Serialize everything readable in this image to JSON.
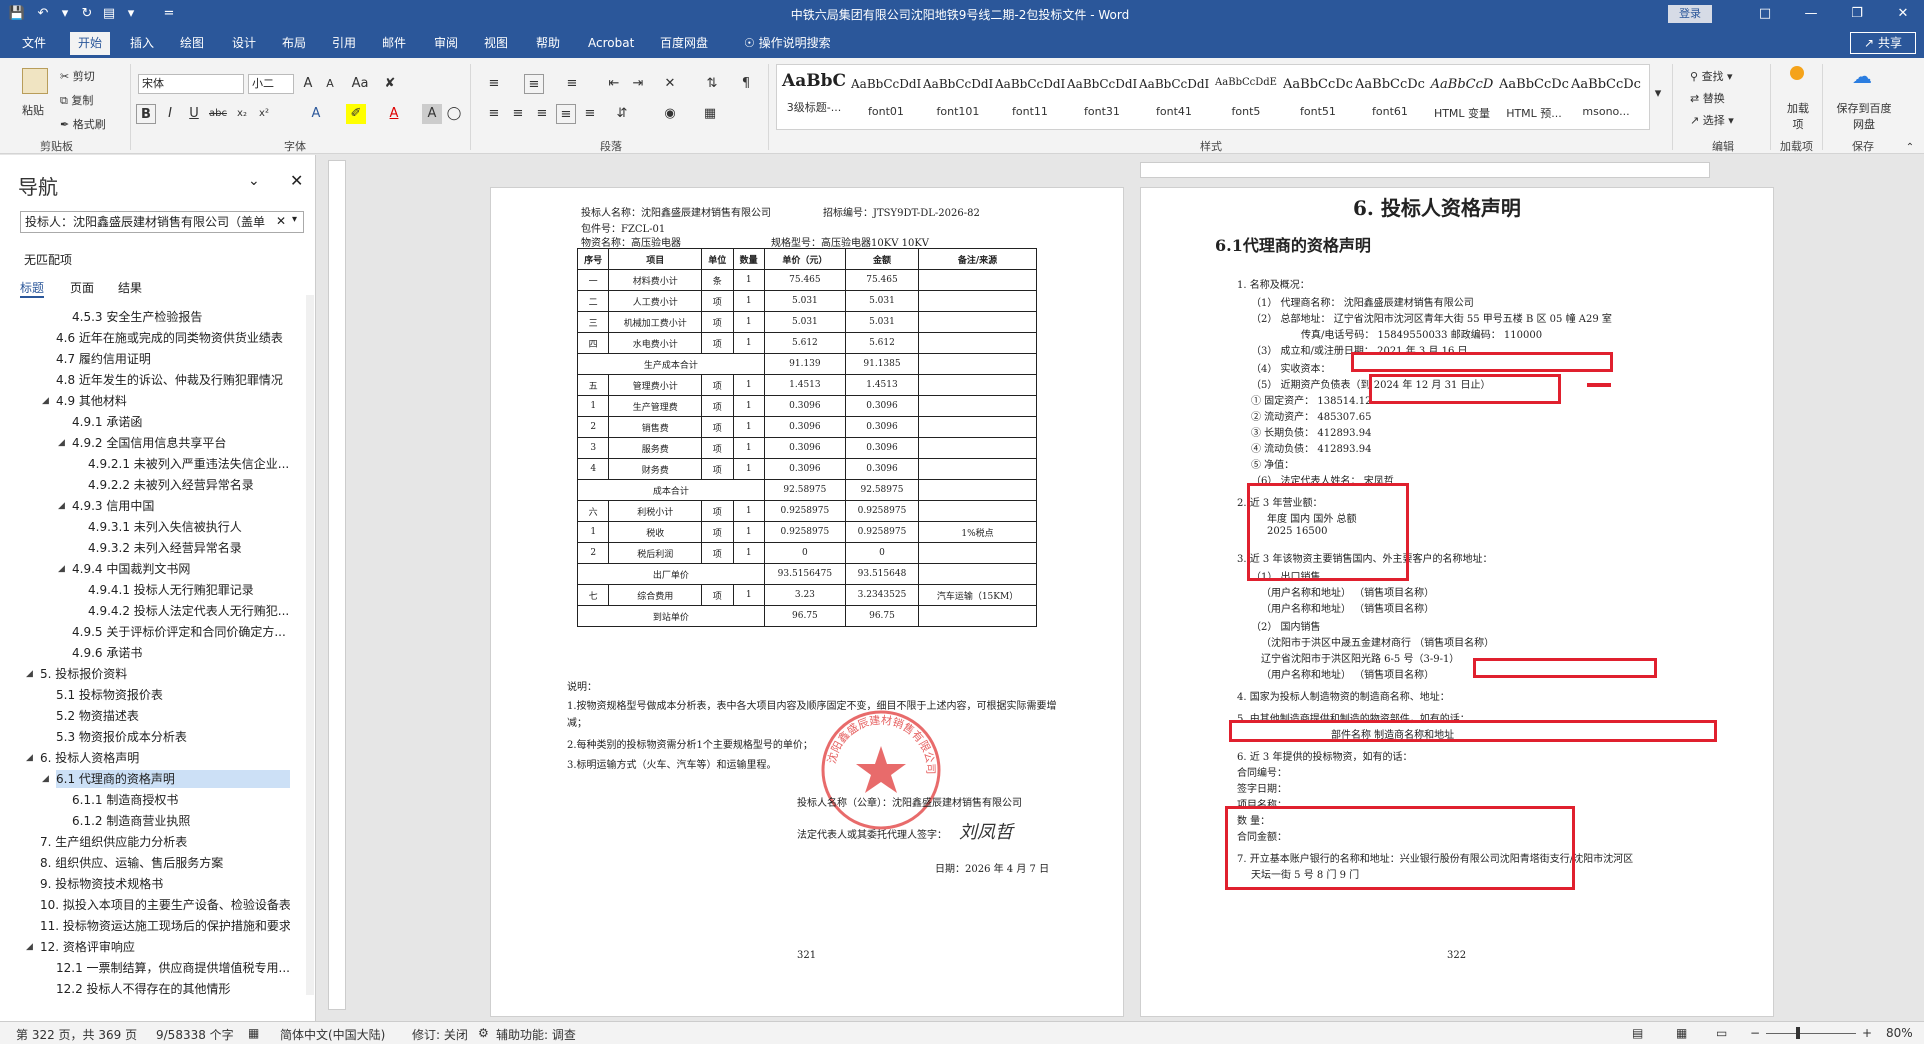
{
  "window": {
    "title": "中铁六局集团有限公司沈阳地铁9号线二期-2包投标文件 - Word",
    "login": "登录",
    "share": "共享"
  },
  "tabs": [
    "文件",
    "开始",
    "插入",
    "绘图",
    "设计",
    "布局",
    "引用",
    "邮件",
    "审阅",
    "视图",
    "帮助",
    "Acrobat",
    "百度网盘",
    "操作说明搜索"
  ],
  "ribbon": {
    "clipboard": {
      "paste": "粘贴",
      "cut": "剪切",
      "copy": "复制",
      "format_painter": "格式刷",
      "label": "剪贴板"
    },
    "font": {
      "name": "宋体",
      "size": "小二",
      "label": "字体"
    },
    "paragraph": {
      "label": "段落"
    },
    "styles": {
      "label": "样式",
      "items": [
        {
          "preview": "AaBbC",
          "name": "3级标题-..."
        },
        {
          "preview": "AaBbCcDdI",
          "name": "font01"
        },
        {
          "preview": "AaBbCcDdI",
          "name": "font101"
        },
        {
          "preview": "AaBbCcDdI",
          "name": "font11"
        },
        {
          "preview": "AaBbCcDdI",
          "name": "font31"
        },
        {
          "preview": "AaBbCcDdI",
          "name": "font41"
        },
        {
          "preview": "AaBbCcDdE",
          "name": "font5"
        },
        {
          "preview": "AaBbCcDc",
          "name": "font51"
        },
        {
          "preview": "AaBbCcDc",
          "name": "font61"
        },
        {
          "preview": "AaBbCcD",
          "name": "HTML 变量"
        },
        {
          "preview": "AaBbCcDc",
          "name": "HTML 预..."
        },
        {
          "preview": "AaBbCcDc",
          "name": "msono..."
        }
      ]
    },
    "editing": {
      "find": "查找",
      "replace": "替换",
      "select": "选择",
      "label": "编辑"
    },
    "addins": {
      "load": "加载项",
      "label": "加载项"
    },
    "save": {
      "baidu": "保存到百度网盘",
      "label": "保存"
    }
  },
  "nav": {
    "title": "导航",
    "search": "投标人：沈阳鑫盛辰建材销售有限公司（盖单",
    "no_match": "无匹配项",
    "tabs": [
      "标题",
      "页面",
      "结果"
    ],
    "items": [
      {
        "t": "4.5.3 安全生产检验报告",
        "l": 3
      },
      {
        "t": "4.6 近年在施或完成的同类物资供货业绩表",
        "l": 2
      },
      {
        "t": "4.7 履约信用证明",
        "l": 2
      },
      {
        "t": "4.8 近年发生的诉讼、仲裁及行贿犯罪情况",
        "l": 2
      },
      {
        "t": "4.9 其他材料",
        "l": 2,
        "exp": true
      },
      {
        "t": "4.9.1 承诺函",
        "l": 3
      },
      {
        "t": "4.9.2 全国信用信息共享平台",
        "l": 3,
        "exp": true
      },
      {
        "t": "4.9.2.1 未被列入严重违法失信企业...",
        "l": 4
      },
      {
        "t": "4.9.2.2 未被列入经营异常名录",
        "l": 4
      },
      {
        "t": "4.9.3 信用中国",
        "l": 3,
        "exp": true
      },
      {
        "t": "4.9.3.1 未列入失信被执行人",
        "l": 4
      },
      {
        "t": "4.9.3.2 未列入经营异常名录",
        "l": 4
      },
      {
        "t": "4.9.4 中国裁判文书网",
        "l": 3,
        "exp": true
      },
      {
        "t": "4.9.4.1 投标人无行贿犯罪记录",
        "l": 4
      },
      {
        "t": "4.9.4.2 投标人法定代表人无行贿犯...",
        "l": 4
      },
      {
        "t": "4.9.5 关于评标价评定和合同价确定方...",
        "l": 3
      },
      {
        "t": "4.9.6 承诺书",
        "l": 3
      },
      {
        "t": "5. 投标报价资料",
        "l": 1,
        "exp": true
      },
      {
        "t": "5.1 投标物资报价表",
        "l": 2
      },
      {
        "t": "5.2 物资描述表",
        "l": 2
      },
      {
        "t": "5.3 物资报价成本分析表",
        "l": 2
      },
      {
        "t": "6. 投标人资格声明",
        "l": 1,
        "exp": true
      },
      {
        "t": "6.1 代理商的资格声明",
        "l": 2,
        "exp": true,
        "sel": true
      },
      {
        "t": "6.1.1 制造商授权书",
        "l": 3
      },
      {
        "t": "6.1.2 制造商营业执照",
        "l": 3
      },
      {
        "t": "7. 生产组织供应能力分析表",
        "l": 1
      },
      {
        "t": "8. 组织供应、运输、售后服务方案",
        "l": 1
      },
      {
        "t": "9. 投标物资技术规格书",
        "l": 1
      },
      {
        "t": "10. 拟投入本项目的主要生产设备、检验设备表",
        "l": 1
      },
      {
        "t": "11. 投标物资运达施工现场后的保护措施和要求",
        "l": 1
      },
      {
        "t": "12. 资格评审响应",
        "l": 1,
        "exp": true
      },
      {
        "t": "12.1 一票制结算，供应商提供增值税专用...",
        "l": 2
      },
      {
        "t": "12.2 投标人不得存在的其他情形",
        "l": 2
      }
    ]
  },
  "page1": {
    "header_lines": [
      "投标人名称：沈阳鑫盛辰建材销售有限公司",
      "招标编号：JTSY9DT-DL-2026-82",
      "包件号：FZCL-01",
      "物资名称：高压验电器",
      "规格型号：高压验电器10KV 10KV"
    ],
    "table_head": [
      "序号",
      "项目",
      "单位",
      "数量",
      "单价（元）",
      "金额",
      "备注/来源"
    ],
    "rows": [
      [
        "一",
        "材料费小计",
        "条",
        "1",
        "75.465",
        "75.465",
        ""
      ],
      [
        "二",
        "人工费小计",
        "项",
        "1",
        "5.031",
        "5.031",
        ""
      ],
      [
        "三",
        "机械加工费小计",
        "项",
        "1",
        "5.031",
        "5.031",
        ""
      ],
      [
        "四",
        "水电费小计",
        "项",
        "1",
        "5.612",
        "5.612",
        ""
      ],
      [
        "生产成本合计",
        "",
        "",
        "",
        "91.139",
        "91.1385",
        ""
      ],
      [
        "五",
        "管理费小计",
        "项",
        "1",
        "1.4513",
        "1.4513",
        ""
      ],
      [
        "1",
        "生产管理费",
        "项",
        "1",
        "0.3096",
        "0.3096",
        ""
      ],
      [
        "2",
        "销售费",
        "项",
        "1",
        "0.3096",
        "0.3096",
        ""
      ],
      [
        "3",
        "服务费",
        "项",
        "1",
        "0.3096",
        "0.3096",
        ""
      ],
      [
        "4",
        "财务费",
        "项",
        "1",
        "0.3096",
        "0.3096",
        ""
      ],
      [
        "成本合计",
        "",
        "",
        "",
        "92.58975",
        "92.58975",
        ""
      ],
      [
        "六",
        "利税小计",
        "项",
        "1",
        "0.9258975",
        "0.9258975",
        ""
      ],
      [
        "1",
        "税收",
        "项",
        "1",
        "0.9258975",
        "0.9258975",
        "1%税点"
      ],
      [
        "2",
        "税后利润",
        "项",
        "1",
        "0",
        "0",
        ""
      ],
      [
        "出厂单价",
        "",
        "",
        "",
        "93.5156475",
        "93.515648",
        ""
      ],
      [
        "七",
        "综合费用",
        "项",
        "1",
        "3.23",
        "3.2343525",
        "汽车运输（15KM）"
      ],
      [
        "到站单价",
        "",
        "",
        "",
        "96.75",
        "96.75",
        ""
      ]
    ],
    "notes": [
      "说明：",
      "1.按物资规格型号做成本分析表，表中各大项目内容及顺序固定不变，细目不限于上述内容，可根据实际需要增减；",
      "2.每种类别的投标物资需分析1个主要规格型号的单价；",
      "3.标明运输方式（火车、汽车等）和运输里程。"
    ],
    "sign_company": "投标人名称（公章）：沈阳鑫盛辰建材销售有限公司",
    "sign_rep": "法定代表人或其委托代理人签字：",
    "signature": "刘凤哲",
    "date": "日期：2026 年 4 月 7 日",
    "page_no": "321",
    "seal_text": "沈阳鑫盛辰建材销售有限公司"
  },
  "page2": {
    "heading": "6.  投标人资格声明",
    "subheading": "6.1代理商的资格声明",
    "lines": [
      "1.  名称及概况：",
      "（1）  代理商名称：  沈阳鑫盛辰建材销售有限公司",
      "（2）  总部地址：  辽宁省沈阳市沈河区青年大街 55 甲号五楼 B 区 05 幢 A29 室",
      "传真/电话号码：  15849550033    邮政编码：  110000",
      "（3）  成立和/或注册日期：  2021 年 3 月 16 日",
      "（4）  实收资本：",
      "（5）  近期资产负债表（到 2024 年 12 月 31 日止）",
      "①  固定资产：  138514.12",
      "②  流动资产：  485307.65",
      "③  长期负债：  412893.94",
      "④  流动负债：  412893.94",
      "⑤  净值：",
      "（6）  法定代表人姓名：  宋凤哲",
      "2.  近 3 年营业额：",
      "年度        国内        国外        总额",
      "2025        16500",
      "3.  近 3 年该物资主要销售国内、外主要客户的名称地址：",
      "（1）  出口销售",
      "（用户名称和地址）                （销售项目名称）",
      "（用户名称和地址）                （销售项目名称）",
      "（2）  国内销售",
      "（沈阳市于洪区中晟五金建材商行          （销售项目名称）",
      "辽宁省沈阳市于洪区阳光路 6-5 号（3-9-1）",
      "（用户名称和地址）                （销售项目名称）",
      "4.  国家为投标人制造物资的制造商名称、地址：",
      "5.  由其他制造商提供和制造的物资部件，如有的话：",
      "部件名称                      制造商名称和地址",
      "6.  近 3 年提供的投标物资，如有的话：",
      "合同编号：",
      "签字日期：",
      "项目名称：",
      "数    量：",
      "合同金额：",
      "7.  开立基本账户银行的名称和地址：兴业银行股份有限公司沈阳青塔街支行/沈阳市沈河区",
      "天坛一街 5 号 8 门 9 门"
    ],
    "page_no": "322"
  },
  "status": {
    "page": "第 322 页，共 369 页",
    "words": "9/58338 个字",
    "lang": "简体中文(中国大陆)",
    "track": "修订: 关闭",
    "access": "辅助功能: 调查",
    "zoom": "80%"
  }
}
